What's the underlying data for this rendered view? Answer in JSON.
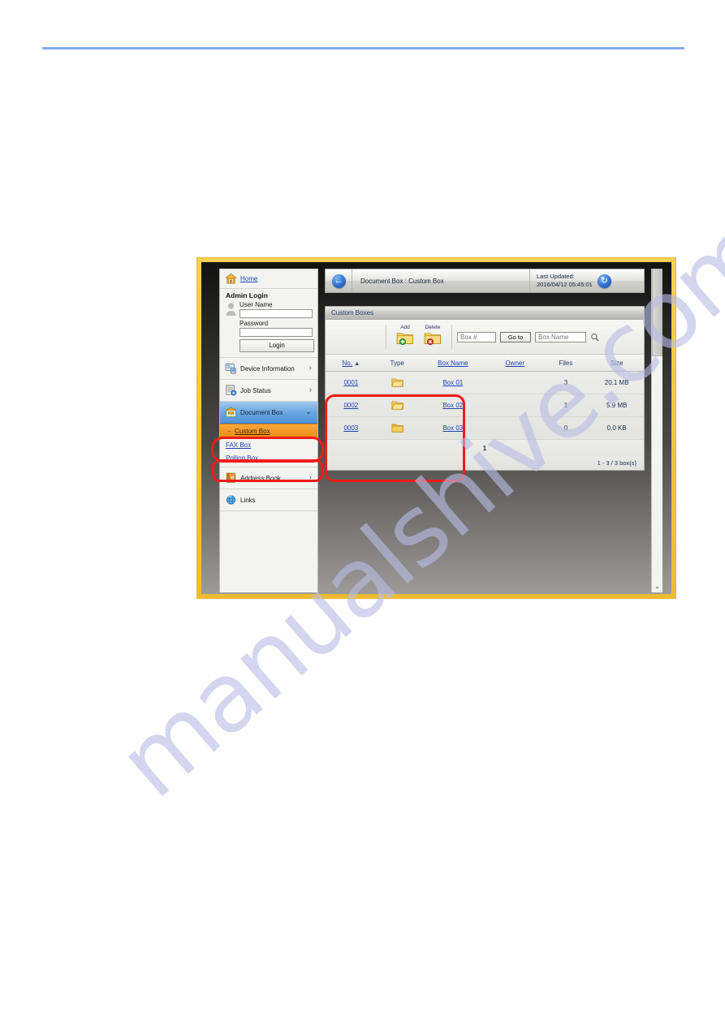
{
  "page": {
    "watermark": "manualshive.com",
    "rule_color": "#83aeea"
  },
  "window": {
    "frame_color": "#eebc2e",
    "backdrop_color": "#3b3a39"
  },
  "nav": {
    "home": {
      "label": "Home",
      "icon": "home-icon"
    },
    "login": {
      "title": "Admin Login",
      "user_icon": "user-avatar-icon",
      "user_name_label": "User Name",
      "user_name_value": "",
      "user_name_placeholder": "",
      "password_label": "Password",
      "password_value": "",
      "password_placeholder": "",
      "login_button": "Login"
    },
    "items": [
      {
        "label": "Device Information",
        "icon": "device-information-icon",
        "chevron": "›"
      },
      {
        "label": "Job Status",
        "icon": "job-status-icon",
        "chevron": "›"
      },
      {
        "label": "Document Box",
        "icon": "document-box-icon",
        "chevron": "⌄",
        "selected": true
      },
      {
        "label": "Address Book",
        "icon": "address-book-icon",
        "chevron": "›"
      },
      {
        "label": "Links",
        "icon": "links-globe-icon",
        "chevron": ""
      }
    ],
    "subitems": [
      {
        "label": "Custom Box",
        "active": true,
        "bullet": "→"
      },
      {
        "label": "FAX Box",
        "active": false,
        "bullet": ""
      },
      {
        "label": "Polling Box",
        "active": false,
        "bullet": ""
      }
    ]
  },
  "topbar": {
    "back_icon": "back-arrow-icon",
    "breadcrumb": "Document Box : Custom Box",
    "last_updated_label": "Last Updated:",
    "last_updated_value": "2016/04/12 05:45:01",
    "refresh_icon": "refresh-icon"
  },
  "panel": {
    "title": "Custom Boxes",
    "toolbar": {
      "add_label": "Add",
      "add_icon": "folder-add-icon",
      "delete_label": "Delete",
      "delete_icon": "folder-delete-icon",
      "box_number_placeholder": "Box #",
      "box_number_value": "",
      "goto_label": "Go to",
      "box_name_placeholder": "Box Name",
      "box_name_value": "",
      "search_icon": "magnifier-icon"
    },
    "table": {
      "columns": [
        "No.",
        "Type",
        "Box Name",
        "Owner",
        "Files",
        "Size"
      ],
      "sort_column": "No.",
      "sort_arrow": "▲",
      "rows": [
        {
          "no": "0001",
          "type_icon": "folder-open-icon",
          "name": "Box 01",
          "owner": "",
          "files": "3",
          "size": "20.1 MB"
        },
        {
          "no": "0002",
          "type_icon": "folder-open-icon",
          "name": "Box 02",
          "owner": "",
          "files": "1",
          "size": "5.9 MB"
        },
        {
          "no": "0003",
          "type_icon": "folder-closed-icon",
          "name": "Box 03",
          "owner": "",
          "files": "0",
          "size": "0.0 KB"
        }
      ]
    },
    "pager": {
      "current_page": "1"
    },
    "count": "1 - 3 / 3 box(s)"
  },
  "scrollbar": {
    "down_icon": "chevron-down-icon"
  },
  "annotations": {
    "color": "#ee1c18",
    "regions": [
      "document-box-nav-item",
      "custom-box-nav-subitem",
      "custom-box-table-rows"
    ]
  }
}
